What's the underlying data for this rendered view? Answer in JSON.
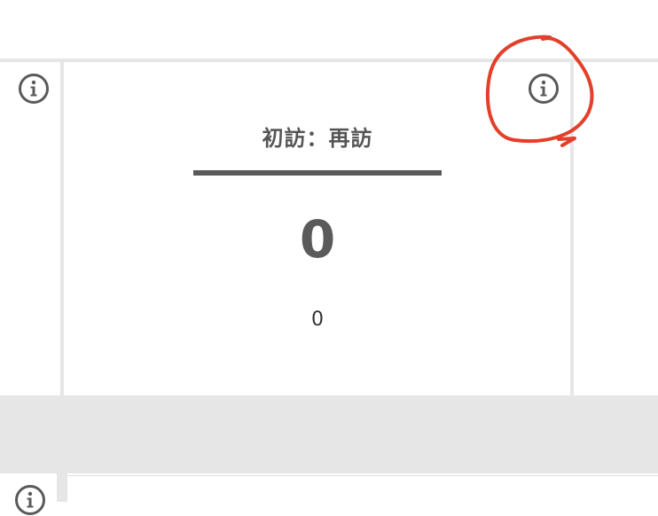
{
  "card": {
    "title": "初訪：再訪",
    "main_value": "0",
    "sub_value": "0"
  },
  "icons": {
    "info": "info-icon"
  },
  "colors": {
    "annotation": "#e2402a",
    "divider": "#e6e6e6",
    "text": "#555555"
  }
}
